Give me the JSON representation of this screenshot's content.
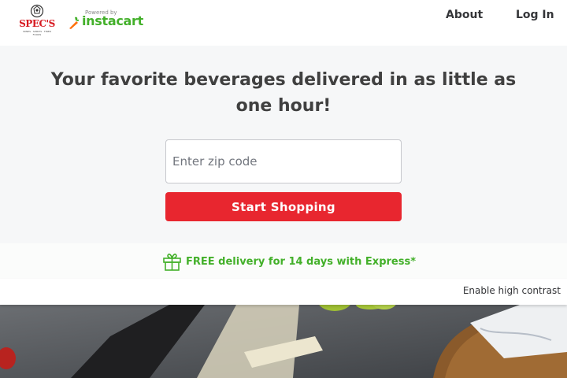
{
  "header": {
    "store_name": "SPEC'S",
    "store_tagline": "WINES · SPIRITS · FINER FOODS",
    "powered_by": "Powered by",
    "partner_name": "instacart",
    "nav": {
      "about": "About",
      "login": "Log In"
    }
  },
  "hero": {
    "headline": "Your favorite beverages delivered in as little as one hour!",
    "zip_placeholder": "Enter zip code",
    "cta_label": "Start Shopping"
  },
  "promo": {
    "text": "FREE delivery for 14 days with Express*"
  },
  "accessibility": {
    "contrast_label": "Enable high contrast"
  },
  "colors": {
    "brand_red": "#e8262f",
    "instacart_green": "#43b02a",
    "hero_background": "#f6f7f8",
    "heading_text": "#404040"
  },
  "icons": {
    "logo": "specs-logo",
    "partner": "instacart-carrot-icon",
    "promo": "gift-icon"
  }
}
